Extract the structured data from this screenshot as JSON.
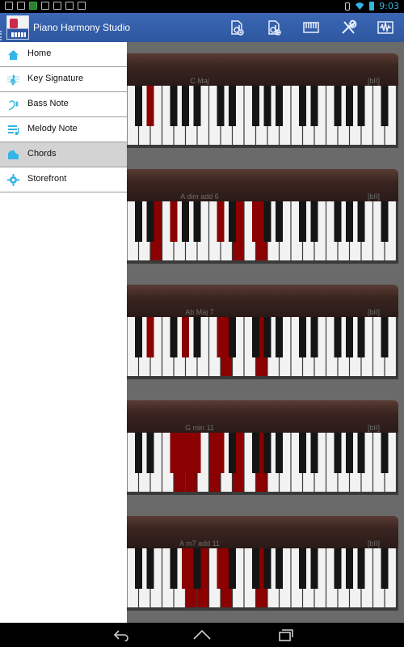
{
  "status_bar": {
    "time": "9:03"
  },
  "app": {
    "title": "Piano Harmony Studio"
  },
  "action_bar": {
    "icons": [
      "music-add-icon",
      "music-play-icon",
      "keyboard-icon",
      "tools-icon",
      "waveform-icon"
    ]
  },
  "drawer": {
    "items": [
      {
        "label": "Home",
        "icon": "home-icon",
        "active": false
      },
      {
        "label": "Key Signature",
        "icon": "treble-clef-icon",
        "active": false
      },
      {
        "label": "Bass Note",
        "icon": "bass-clef-icon",
        "active": false
      },
      {
        "label": "Melody Note",
        "icon": "melody-note-icon",
        "active": false
      },
      {
        "label": "Chords",
        "icon": "piano-icon",
        "active": true
      },
      {
        "label": "Storefront",
        "icon": "gear-icon",
        "active": false
      }
    ]
  },
  "chords": [
    {
      "name": "C  Maj",
      "tag": "[bII]",
      "highlight_white": [],
      "highlight_black": [
        1
      ]
    },
    {
      "name": "A  dim add 6",
      "tag": "[bII]",
      "highlight_white": [
        2,
        9,
        11
      ],
      "highlight_black": [
        2,
        5,
        7
      ]
    },
    {
      "name": "Ab  Maj 7",
      "tag": "[bII]",
      "highlight_white": [
        8,
        11
      ],
      "highlight_black": [
        1,
        3,
        5
      ]
    },
    {
      "name": "G  min 11",
      "tag": "[bII]",
      "highlight_white": [
        4,
        5,
        7,
        9,
        11
      ],
      "highlight_black": [
        2,
        3,
        4,
        5
      ]
    },
    {
      "name": "A  m7 add 11",
      "tag": "[bII]",
      "highlight_white": [
        5,
        6,
        8,
        11
      ],
      "highlight_black": [
        3,
        5
      ]
    }
  ],
  "colors": {
    "action_bar": "#2e579f",
    "accent_blue": "#33b5e5",
    "highlight_red": "#8b0000",
    "drawer_active": "#d3d3d3"
  },
  "nav": {
    "buttons": [
      "back-icon",
      "home-nav-icon",
      "recents-icon"
    ]
  }
}
